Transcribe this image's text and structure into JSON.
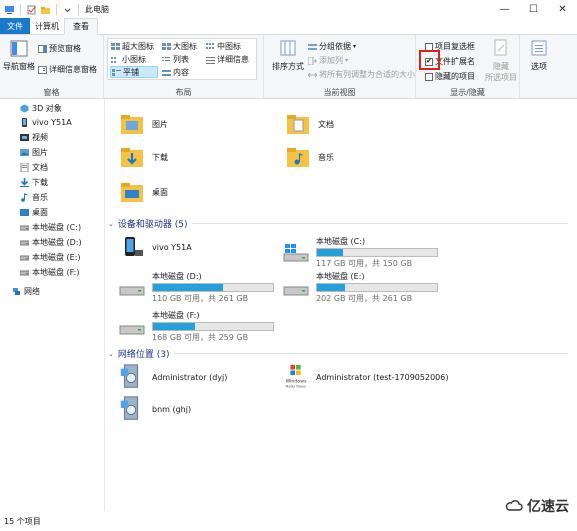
{
  "window": {
    "title": "此电脑",
    "controls": [
      "—",
      "☐",
      "✕"
    ]
  },
  "tabs": [
    "文件",
    "计算机",
    "查看"
  ],
  "ribbon": {
    "panes": {
      "navigation": "导航窗格",
      "preview": "预览窗格",
      "details": "详细信息窗格",
      "label": "窗格"
    },
    "layout": {
      "options": [
        "超大图标",
        "大图标",
        "中图标",
        "小图标",
        "列表",
        "详细信息",
        "平铺",
        "内容"
      ],
      "selected": "平铺",
      "label": "布局"
    },
    "current_view": {
      "sort": "排序方式",
      "group_by": "分组依据",
      "add_column": "添加列",
      "fit_columns": "将所有列调整为合适的大小",
      "label": "当前视图"
    },
    "show_hide": {
      "item_checkboxes": "项目复选框",
      "item_checkboxes_checked": false,
      "file_extensions": "文件扩展名",
      "file_extensions_checked": true,
      "hidden_items": "隐藏的项目",
      "hidden_items_checked": false,
      "hide": "隐藏",
      "selected_items": "所选项目",
      "label": "显示/隐藏"
    },
    "options": "选项"
  },
  "nav": {
    "items": [
      {
        "label": "3D 对象",
        "icon": "3d-objects-icon"
      },
      {
        "label": "vivo Y51A",
        "icon": "phone-icon"
      },
      {
        "label": "视频",
        "icon": "video-icon"
      },
      {
        "label": "图片",
        "icon": "pictures-icon"
      },
      {
        "label": "文档",
        "icon": "documents-icon"
      },
      {
        "label": "下载",
        "icon": "download-icon"
      },
      {
        "label": "音乐",
        "icon": "music-icon"
      },
      {
        "label": "桌面",
        "icon": "desktop-icon"
      },
      {
        "label": "本地磁盘 (C:)",
        "icon": "drive-icon"
      },
      {
        "label": "本地磁盘 (D:)",
        "icon": "drive-icon"
      },
      {
        "label": "本地磁盘 (E:)",
        "icon": "drive-icon"
      },
      {
        "label": "本地磁盘 (F:)",
        "icon": "drive-icon"
      },
      {
        "label": "网络",
        "icon": "network-icon"
      }
    ]
  },
  "folders": [
    "图片",
    "文档",
    "下载",
    "音乐",
    "桌面"
  ],
  "devices": {
    "header": "设备和驱动器 (5)",
    "items": [
      {
        "name": "vivo Y51A",
        "free": "",
        "used_fraction": null
      },
      {
        "name": "本地磁盘 (C:)",
        "free": "117 GB 可用，共 150 GB",
        "used_fraction": 0.22
      },
      {
        "name": "本地磁盘 (D:)",
        "free": "110 GB 可用，共 261 GB",
        "used_fraction": 0.58
      },
      {
        "name": "本地磁盘 (E:)",
        "free": "202 GB 可用，共 261 GB",
        "used_fraction": 0.23
      },
      {
        "name": "本地磁盘 (F:)",
        "free": "168 GB 可用，共 259 GB",
        "used_fraction": 0.35
      }
    ]
  },
  "network": {
    "header": "网络位置 (3)",
    "items": [
      "Administrator (dyj)",
      "Administrator (test-1709052006)",
      "bnm (ghj)"
    ]
  },
  "status": "15 个项目",
  "watermark": "亿速云",
  "colors": {
    "accent": "#1979ca",
    "bar": "#26a0da",
    "folder": "#f6c243",
    "highlight": "#e0201b"
  }
}
